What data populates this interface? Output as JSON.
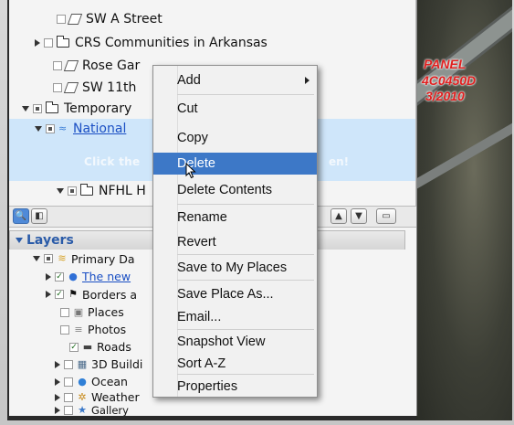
{
  "places_tree": {
    "items": [
      {
        "label": "SW A Street",
        "icon": "polygon-icon"
      },
      {
        "label": "CRS Communities in Arkansas",
        "icon": "folder-icon"
      },
      {
        "label": "Rose Gar",
        "icon": "polygon-icon"
      },
      {
        "label": "SW 11th",
        "icon": "polygon-icon"
      },
      {
        "label": "Temporary",
        "icon": "folder-icon"
      },
      {
        "label": "National",
        "icon": "link-icon"
      },
      {
        "label": "NFHL H",
        "icon": "folder-icon"
      }
    ],
    "selected_hint_left": "Click the",
    "selected_hint_right": "en!"
  },
  "layers": {
    "header": "Layers",
    "items": [
      {
        "label": "Primary Da",
        "icon": "layers-icon"
      },
      {
        "label": "The new",
        "icon": "globe-icon"
      },
      {
        "label": "Borders a",
        "icon": "flag-icon"
      },
      {
        "label": "Places",
        "icon": "places-icon"
      },
      {
        "label": "Photos",
        "icon": "photos-icon"
      },
      {
        "label": "Roads",
        "icon": "roads-icon"
      },
      {
        "label": "3D Buildi",
        "icon": "buildings-icon"
      },
      {
        "label": "Ocean",
        "icon": "ocean-icon"
      },
      {
        "label": "Weather",
        "icon": "weather-icon"
      },
      {
        "label": "Gallery",
        "icon": "gallery-icon"
      }
    ]
  },
  "context_menu": {
    "items": [
      {
        "label": "Add",
        "has_submenu": true
      },
      {
        "label": "Cut"
      },
      {
        "label": "Copy"
      },
      {
        "label": "Delete",
        "highlighted": true
      },
      {
        "label": "Delete Contents"
      },
      {
        "label": "Rename"
      },
      {
        "label": "Revert"
      },
      {
        "label": "Save to My Places"
      },
      {
        "label": "Save Place As..."
      },
      {
        "label": "Email..."
      },
      {
        "label": "Snapshot View"
      },
      {
        "label": "Sort A-Z"
      },
      {
        "label": "Properties"
      }
    ]
  },
  "map_labels": {
    "line1": "PANEL",
    "line2": "4C0450D",
    "line3": "3/2010"
  },
  "colors": {
    "highlight": "#3d78c7",
    "selected_row": "#cfe6fa",
    "link": "#1a4fc4",
    "map_label": "#e02020"
  }
}
